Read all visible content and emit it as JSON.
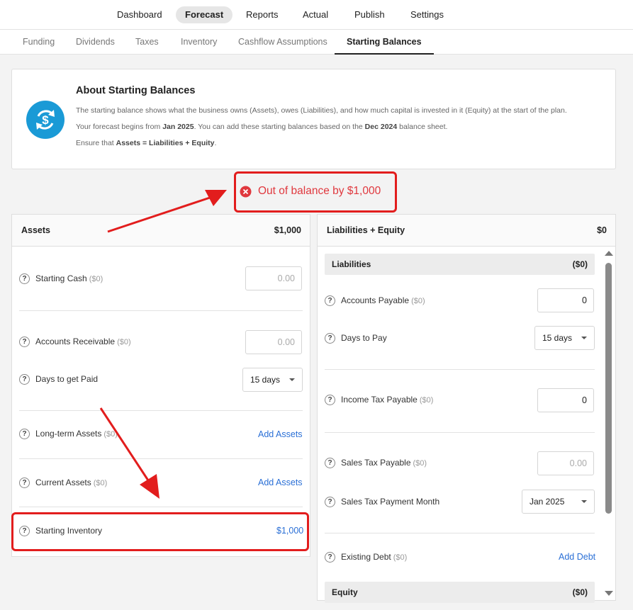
{
  "topnav": {
    "items": [
      "Dashboard",
      "Forecast",
      "Reports",
      "Actual",
      "Publish",
      "Settings"
    ],
    "active": "Forecast"
  },
  "subnav": {
    "tabs": [
      "Funding",
      "Dividends",
      "Taxes",
      "Inventory",
      "Cashflow Assumptions",
      "Starting Balances"
    ],
    "active": "Starting Balances"
  },
  "about": {
    "title": "About Starting Balances",
    "icon": "dollar-cycle-icon",
    "line1": "The starting balance shows what the business owns (Assets), owes (Liabilities), and how much capital is invested in it (Equity) at the start of the plan.",
    "line2_pre": "Your forecast begins from ",
    "line2_b1": "Jan 2025",
    "line2_mid": ". You can add these starting balances based on the ",
    "line2_b2": "Dec 2024",
    "line2_post": " balance sheet.",
    "line3_pre": "Ensure that ",
    "line3_b": "Assets = Liabilities + Equity",
    "line3_post": "."
  },
  "alert": {
    "text": "Out of balance by $1,000",
    "color": "#e0383e"
  },
  "assets": {
    "title": "Assets",
    "total": "$1,000",
    "starting_cash": {
      "label": "Starting Cash",
      "sub": "($0)",
      "placeholder": "0.00"
    },
    "accounts_receivable": {
      "label": "Accounts Receivable",
      "sub": "($0)",
      "placeholder": "0.00"
    },
    "days_to_get_paid": {
      "label": "Days to get Paid",
      "value": "15 days"
    },
    "long_term_assets": {
      "label": "Long-term Assets",
      "sub": "($0)",
      "link": "Add Assets"
    },
    "current_assets": {
      "label": "Current Assets",
      "sub": "($0)",
      "link": "Add Assets"
    },
    "starting_inventory": {
      "label": "Starting Inventory",
      "link": "$1,000"
    }
  },
  "liabilities_equity": {
    "title": "Liabilities + Equity",
    "total": "$0",
    "liabilities": {
      "title": "Liabilities",
      "total": "($0)"
    },
    "accounts_payable": {
      "label": "Accounts Payable",
      "sub": "($0)",
      "value": "0"
    },
    "days_to_pay": {
      "label": "Days to Pay",
      "value": "15 days"
    },
    "income_tax_payable": {
      "label": "Income Tax Payable",
      "sub": "($0)",
      "value": "0"
    },
    "sales_tax_payable": {
      "label": "Sales Tax Payable",
      "sub": "($0)",
      "placeholder": "0.00"
    },
    "sales_tax_payment_month": {
      "label": "Sales Tax Payment Month",
      "value": "Jan 2025"
    },
    "existing_debt": {
      "label": "Existing Debt",
      "sub": "($0)",
      "link": "Add Debt"
    },
    "equity": {
      "title": "Equity",
      "total": "($0)"
    }
  },
  "colors": {
    "accent_link": "#2a6fd6",
    "annotation_red": "#e21d1d",
    "badge_blue": "#1a9ad6"
  }
}
